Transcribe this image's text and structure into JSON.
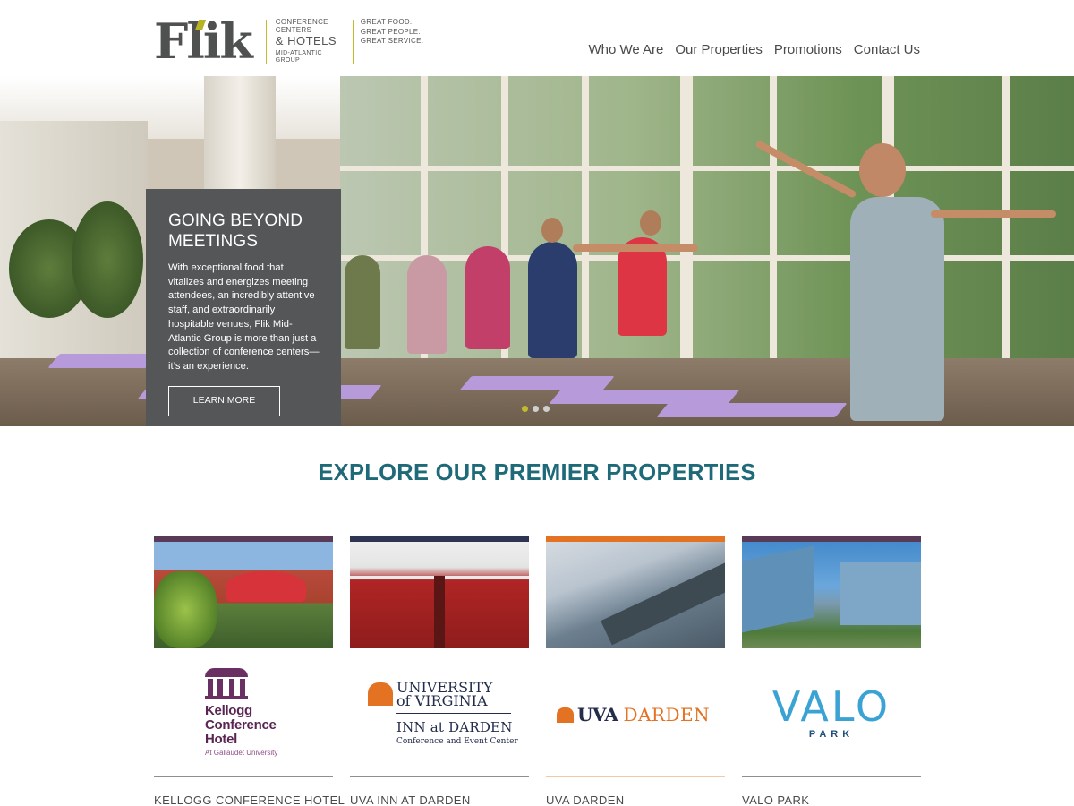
{
  "brand": {
    "mark": "Flik",
    "line1": "CONFERENCE",
    "line2": "CENTERS",
    "line3": "& HOTELS",
    "line4": "MID-ATLANTIC",
    "line5": "GROUP",
    "tagline": [
      "GREAT FOOD.",
      "GREAT PEOPLE.",
      "GREAT SERVICE."
    ],
    "accent_color": "#c1ba2f"
  },
  "nav": {
    "items": [
      "Who We Are",
      "Our Properties",
      "Promotions",
      "Contact Us"
    ]
  },
  "hero": {
    "title": "GOING BEYOND MEETINGS",
    "body": "With exceptional food that vitalizes and energizes meeting attendees, an incredibly attentive staff, and extraordinarily hospitable venues, Flik Mid-Atlantic Group is more than just a collection of conference centers—it’s an experience.",
    "button": "LEARN MORE",
    "slide_count": 3,
    "active_slide": 1
  },
  "properties": {
    "heading": "EXPLORE OUR PREMIER PROPERTIES",
    "heading_color": "#1f6a78",
    "items": [
      {
        "name": "KELLOGG CONFERENCE HOTEL",
        "bar_color": "#5a3b57",
        "logo": {
          "l1": "Kellogg",
          "l2": "Conference",
          "l3": "Hotel",
          "sub": "At Gallaudet University"
        }
      },
      {
        "name": "UVA INN AT DARDEN",
        "bar_color": "#2d3552",
        "logo": {
          "l1": "UNIVERSITY",
          "l2": "of VIRGINIA",
          "inn": "INN at DARDEN",
          "sub": "Conference and Event Center"
        }
      },
      {
        "name": "UVA DARDEN",
        "bar_color": "#e37222",
        "logo": {
          "uva": "UVA",
          "darden": "DARDEN"
        }
      },
      {
        "name": "VALO PARK",
        "bar_color": "#5a3b57",
        "logo": {
          "main": "VALO",
          "sub": "PARK"
        }
      }
    ]
  }
}
